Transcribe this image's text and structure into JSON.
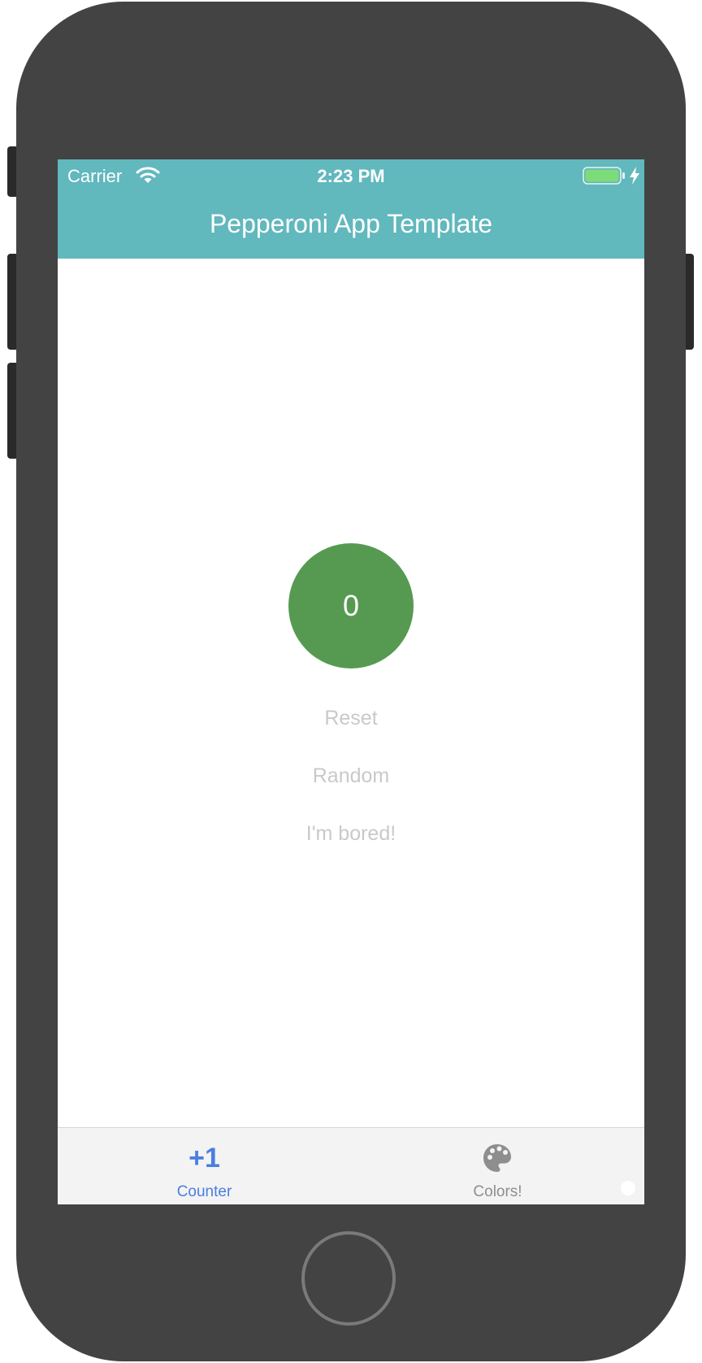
{
  "status_bar": {
    "carrier": "Carrier",
    "time": "2:23 PM",
    "wifi_icon": "wifi-icon",
    "battery_icon": "battery-icon",
    "charging_icon": "charging-bolt-icon"
  },
  "header": {
    "title": "Pepperoni App Template",
    "background_color": "#61b8bd"
  },
  "counter": {
    "value": "0",
    "color": "#569a52"
  },
  "actions": {
    "reset_label": "Reset",
    "random_label": "Random",
    "bored_label": "I'm bored!"
  },
  "tabbar": {
    "tabs": [
      {
        "icon_text": "+1",
        "label": "Counter",
        "selected": true,
        "color": "#4a7fe0"
      },
      {
        "icon": "palette-icon",
        "label": "Colors!",
        "selected": false,
        "color": "#8e8e8e"
      }
    ]
  }
}
